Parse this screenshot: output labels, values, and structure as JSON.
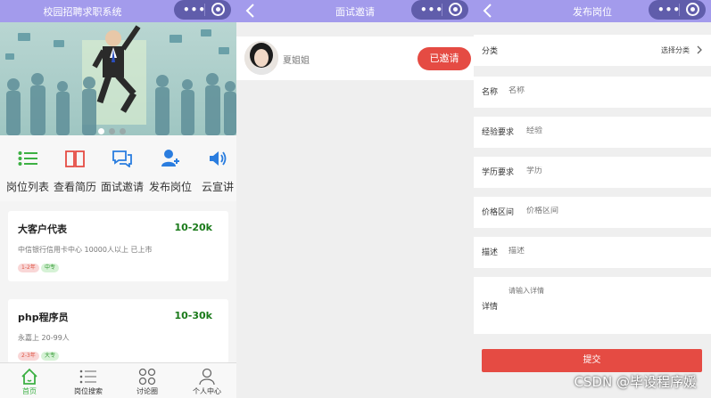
{
  "home": {
    "nav_title": "校园招聘求职系统",
    "menu": [
      {
        "label": "岗位列表",
        "icon": "list-icon"
      },
      {
        "label": "查看简历",
        "icon": "book-icon"
      },
      {
        "label": "面试邀请",
        "icon": "chat-icon"
      },
      {
        "label": "发布岗位",
        "icon": "add-user-icon"
      },
      {
        "label": "云宣讲",
        "icon": "speaker-icon"
      }
    ],
    "jobs": [
      {
        "title": "大客户代表",
        "salary": "10-20k",
        "info": "中信银行信用卡中心 10000人以上 已上市",
        "experience": "1-2年",
        "education": "中专"
      },
      {
        "title": "php程序员",
        "salary": "10-30k",
        "info": "永嘉上 20-99人",
        "experience": "2-3年",
        "education": "大专"
      }
    ],
    "tabs": [
      {
        "label": "首页",
        "icon": "home-icon"
      },
      {
        "label": "岗位搜索",
        "icon": "list-icon"
      },
      {
        "label": "讨论圈",
        "icon": "grid-icon"
      },
      {
        "label": "个人中心",
        "icon": "person-icon"
      }
    ]
  },
  "invite": {
    "nav_title": "面试邀请",
    "name": "夏姐姐",
    "button": "已邀请"
  },
  "publish": {
    "nav_title": "发布岗位",
    "category_label": "分类",
    "category_value": "选择分类",
    "fields": [
      {
        "label": "名称",
        "placeholder": "名称"
      },
      {
        "label": "经验要求",
        "placeholder": "经验"
      },
      {
        "label": "学历要求",
        "placeholder": "学历"
      },
      {
        "label": "价格区间",
        "placeholder": "价格区间"
      },
      {
        "label": "描述",
        "placeholder": "描述"
      }
    ],
    "detail_label": "详情",
    "detail_placeholder": "请输入详情",
    "submit": "提交"
  },
  "watermark": "CSDN @毕设程序媛",
  "colors": {
    "nav": "#a39bec",
    "accent_red": "#e54b43",
    "salary_green": "#1a7a1a",
    "tab_active": "#3cb043"
  }
}
